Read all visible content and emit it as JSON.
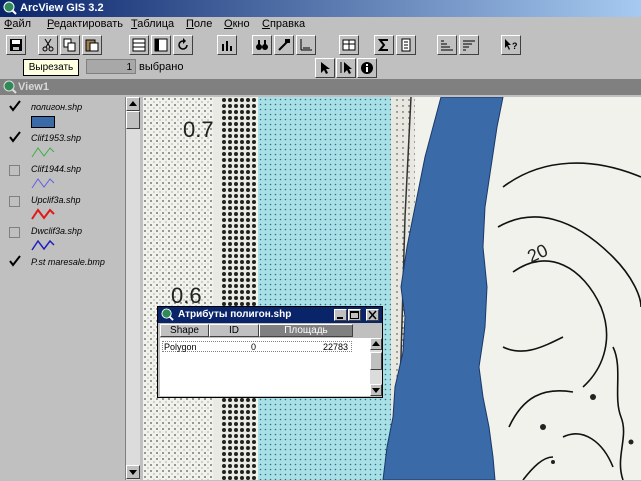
{
  "app": {
    "title": "ArcView GIS 3.2"
  },
  "menu": [
    {
      "label": "Файл",
      "underline": "Ф"
    },
    {
      "label": "Редактировать",
      "underline": "Р"
    },
    {
      "label": "Таблица",
      "underline": "Т"
    },
    {
      "label": "Поле",
      "underline": "П"
    },
    {
      "label": "Окно",
      "underline": "О"
    },
    {
      "label": "Справка",
      "underline": "С"
    }
  ],
  "toolbar": {
    "buttons": [
      "save-icon",
      "cut-icon",
      "copy-icon",
      "paste-icon",
      "select-all-icon",
      "select-none-icon",
      "refresh-icon",
      "chart-icon",
      "find-icon",
      "query-icon",
      "sort-icon",
      "join-icon",
      "sum-icon",
      "stats-icon",
      "sort-asc-icon",
      "sort-desc-icon",
      "help-icon"
    ],
    "tooltip": "Вырезать",
    "selected_count": "1",
    "selected_label": "выбрано",
    "tools": [
      "pointer-icon",
      "edit-pointer-icon",
      "info-icon"
    ]
  },
  "view": {
    "title": "View1"
  },
  "toc": {
    "layers": [
      {
        "name": "полигон.shp",
        "checked": true,
        "legend": "fill",
        "color": "#3a6aa8"
      },
      {
        "name": "Clif1953.shp",
        "checked": true,
        "legend": "line",
        "color": "#3cb043"
      },
      {
        "name": "Clif1944.shp",
        "checked": false,
        "legend": "line",
        "color": "#6060e0"
      },
      {
        "name": "Upclif3a.shp",
        "checked": false,
        "legend": "line",
        "color": "#e01818"
      },
      {
        "name": "Dwclif3a.shp",
        "checked": false,
        "legend": "line",
        "color": "#2020c0"
      },
      {
        "name": "P.st maresale.bmp",
        "checked": true,
        "legend": "none",
        "color": ""
      }
    ]
  },
  "map": {
    "labels": [
      "0.7",
      "0.6",
      "20"
    ],
    "polygon_color": "#3a6aa8",
    "band_color": "#a8e0e8"
  },
  "attribute_table": {
    "title": "Атрибуты полигон.shp",
    "columns": [
      "Shape",
      "ID",
      "Площадь"
    ],
    "rows": [
      [
        "Polygon",
        "0",
        "22783"
      ]
    ]
  }
}
